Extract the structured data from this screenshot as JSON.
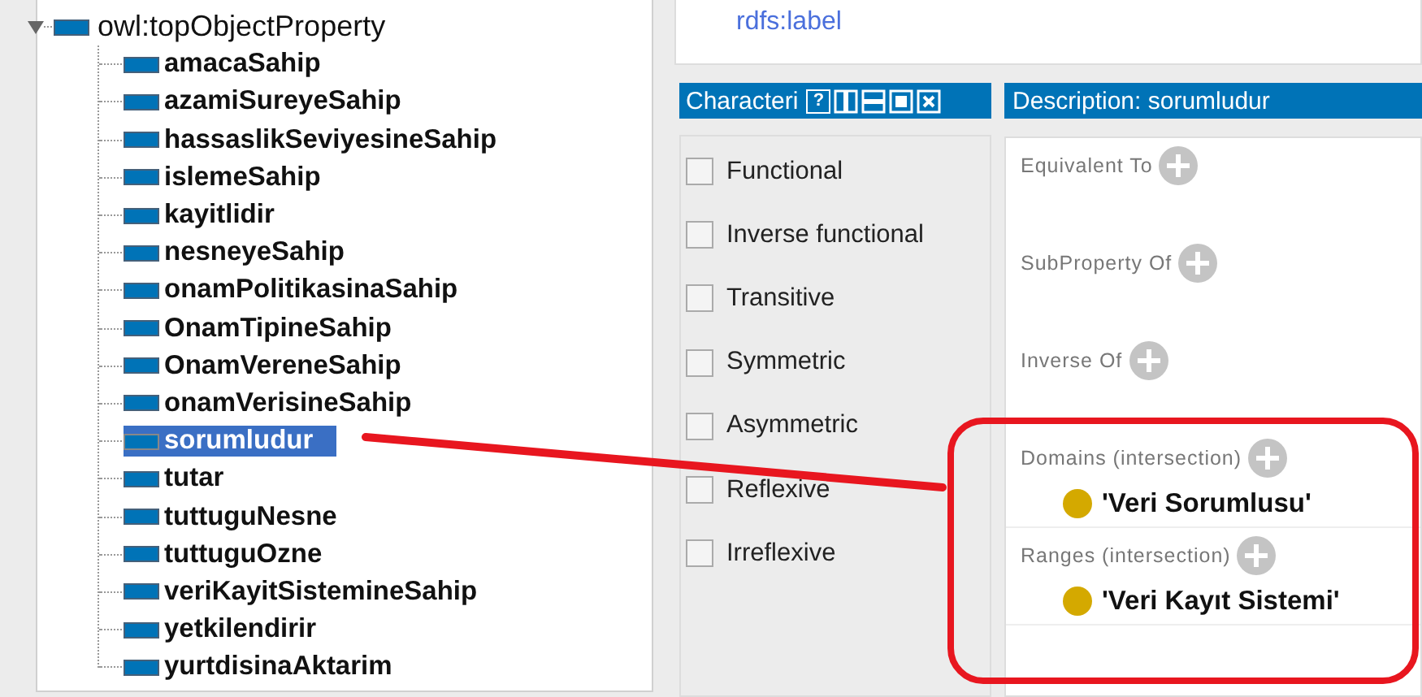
{
  "tree": {
    "label": "owl:topObjectProperty",
    "expanded": true,
    "selected": false,
    "children": [
      {
        "label": "amacaSahip",
        "selected": false
      },
      {
        "label": "azamiSureyeSahip",
        "selected": false
      },
      {
        "label": "hassaslikSeviyesineSahip",
        "selected": false
      },
      {
        "label": "islemeSahip",
        "selected": false
      },
      {
        "label": "kayitlidir",
        "selected": false
      },
      {
        "label": "nesneyeSahip",
        "selected": false
      },
      {
        "label": "onamPolitikasinaSahip",
        "selected": false
      },
      {
        "label": "OnamTipineSahip",
        "selected": false
      },
      {
        "label": "OnamVereneSahip",
        "selected": false
      },
      {
        "label": "onamVerisineSahip",
        "selected": false
      },
      {
        "label": "sorumludur",
        "selected": true
      },
      {
        "label": "tutar",
        "selected": false
      },
      {
        "label": "tuttuguNesne",
        "selected": false
      },
      {
        "label": "tuttuguOzne",
        "selected": false
      },
      {
        "label": "veriKayitSistemineSahip",
        "selected": false
      },
      {
        "label": "yetkilendirir",
        "selected": false
      },
      {
        "label": "yurtdisinaAktarim",
        "selected": false
      }
    ]
  },
  "annotations_panel": {
    "property": "rdfs:label"
  },
  "characteristics": {
    "title": "Characteri",
    "buttons": [
      {
        "kind": "help",
        "label": "?"
      },
      {
        "kind": "split-vertical"
      },
      {
        "kind": "split-horizontal"
      },
      {
        "kind": "maximize"
      },
      {
        "kind": "close"
      }
    ],
    "items": [
      {
        "label": "Functional",
        "checked": false
      },
      {
        "label": "Inverse functional",
        "checked": false
      },
      {
        "label": "Transitive",
        "checked": false
      },
      {
        "label": "Symmetric",
        "checked": false
      },
      {
        "label": "Asymmetric",
        "checked": false
      },
      {
        "label": "Reflexive",
        "checked": false
      },
      {
        "label": "Irreflexive",
        "checked": false
      }
    ]
  },
  "description": {
    "title": "Description: sorumludur",
    "sections": [
      {
        "label": "Equivalent To"
      },
      {
        "label": "SubProperty Of"
      },
      {
        "label": "Inverse Of"
      },
      {
        "label": "Domains (intersection)",
        "items": [
          {
            "label": "'Veri Sorumlusu'",
            "color": "#d4a900"
          }
        ]
      },
      {
        "label": "Ranges (intersection)",
        "items": [
          {
            "label": "'Veri Kayıt Sistemi'",
            "color": "#d4a900"
          }
        ]
      }
    ]
  }
}
